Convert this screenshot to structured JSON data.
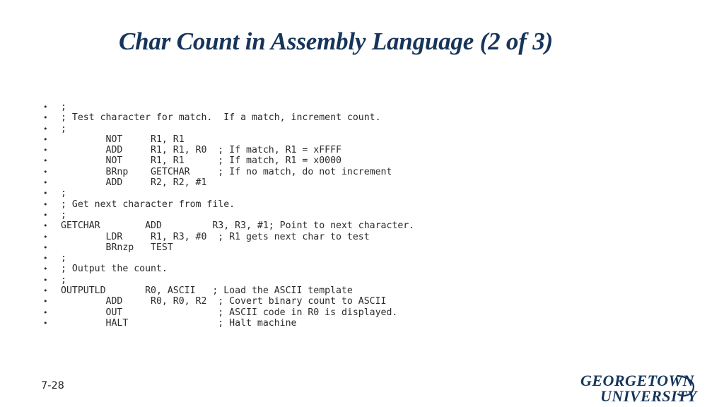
{
  "slide": {
    "title": "Char Count in Assembly Language (2 of 3)",
    "page_number": "7-28",
    "title_color": "#17355b",
    "background_color": "#ffffff",
    "body_text_color": "#2b2b2b"
  },
  "logo": {
    "line1": "GEORGETOWN",
    "line2": "UNIVERSITY",
    "color": "#17355b"
  },
  "code": {
    "bullet_glyph": "•",
    "lines": [
      ";",
      "; Test character for match.  If a match, increment count.",
      ";",
      "        NOT     R1, R1",
      "        ADD     R1, R1, R0  ; If match, R1 = xFFFF",
      "        NOT     R1, R1      ; If match, R1 = x0000",
      "        BRnp    GETCHAR     ; If no match, do not increment",
      "        ADD     R2, R2, #1",
      ";",
      "; Get next character from file.",
      ";",
      "GETCHAR        ADD         R3, R3, #1; Point to next character.",
      "        LDR     R1, R3, #0  ; R1 gets next char to test",
      "        BRnzp   TEST",
      ";",
      "; Output the count.",
      ";",
      "OUTPUTLD       R0, ASCII   ; Load the ASCII template",
      "        ADD     R0, R0, R2  ; Covert binary count to ASCII",
      "        OUT                 ; ASCII code in R0 is displayed.",
      "        HALT                ; Halt machine"
    ]
  }
}
